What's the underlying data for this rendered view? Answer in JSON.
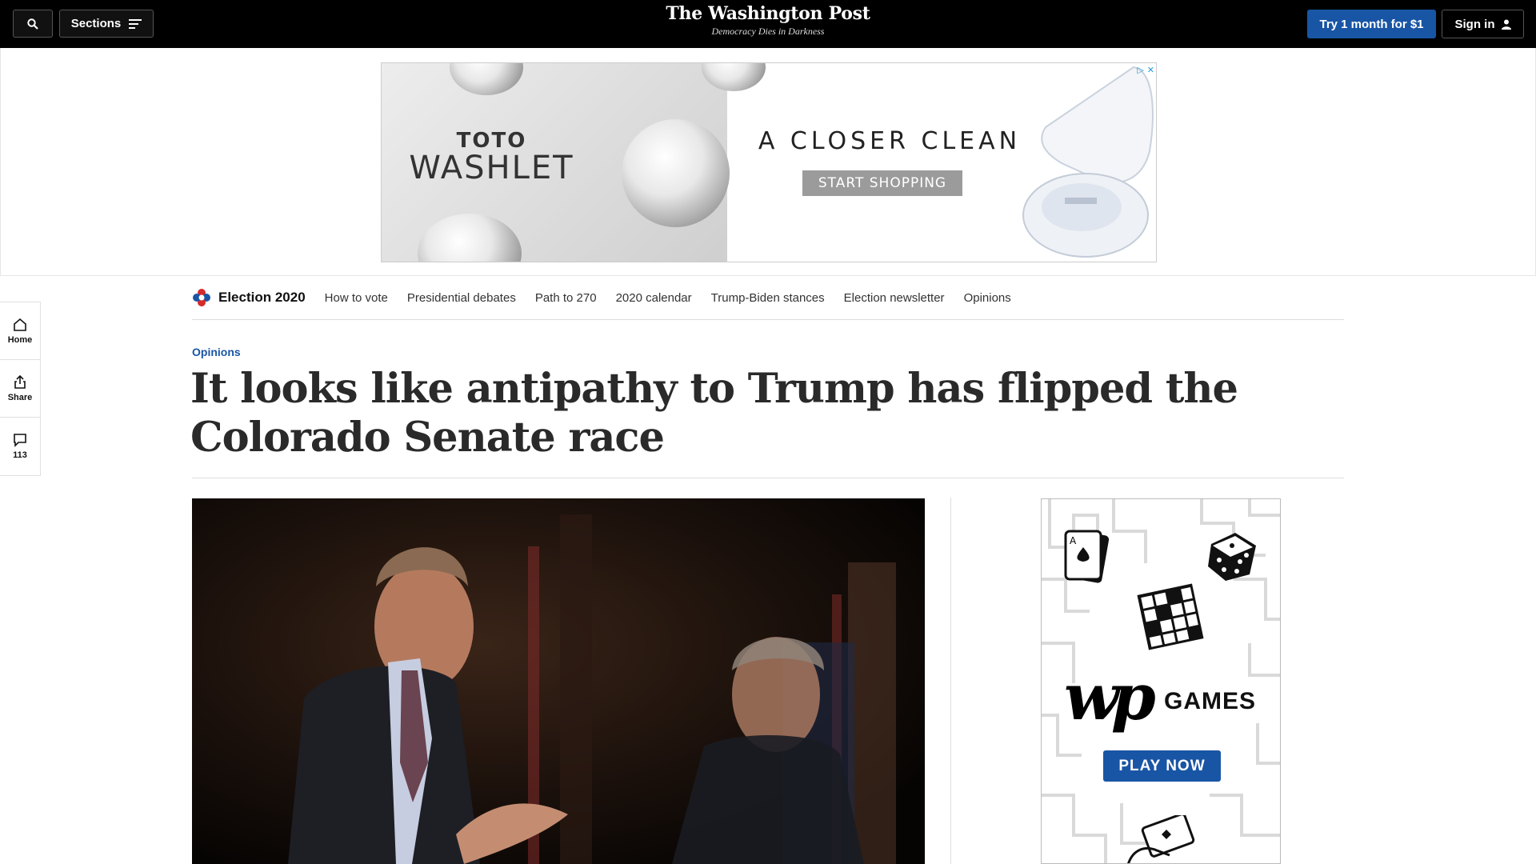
{
  "header": {
    "sections_label": "Sections",
    "brand_name": "The Washington Post",
    "brand_tagline": "Democracy Dies in Darkness",
    "trial_label": "Try 1 month for $1",
    "signin_label": "Sign in"
  },
  "ad_banner": {
    "brand_top": "TOTO",
    "brand_main": "WASHLET",
    "headline": "A CLOSER CLEAN",
    "cta": "START SHOPPING"
  },
  "rail": {
    "home_label": "Home",
    "share_label": "Share",
    "comments_count": "113"
  },
  "election_nav": {
    "title": "Election 2020",
    "links": [
      "How to vote",
      "Presidential debates",
      "Path to 270",
      "2020 calendar",
      "Trump-Biden stances",
      "Election newsletter",
      "Opinions"
    ]
  },
  "article": {
    "kicker": "Opinions",
    "headline": "It looks like antipathy to Trump has flipped the Colorado Senate race"
  },
  "games_ad": {
    "logo": "wp",
    "word": "GAMES",
    "cta": "PLAY NOW"
  },
  "colors": {
    "accent_blue": "#1955a5",
    "topbar": "#000000"
  }
}
